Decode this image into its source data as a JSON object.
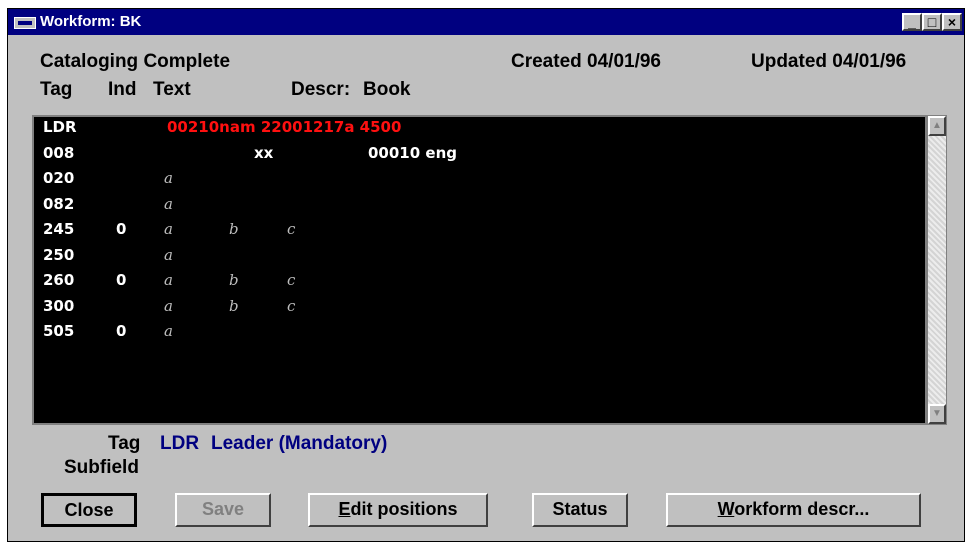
{
  "window": {
    "title": "Workform: BK",
    "controls": {
      "minimize": "_",
      "maximize": "□",
      "close": "×"
    }
  },
  "header": {
    "status": "Cataloging Complete",
    "created": "Created 04/01/96",
    "updated": "Updated 04/01/96",
    "col_tag": "Tag",
    "col_ind": "Ind",
    "col_text": "Text",
    "descr_label": "Descr:",
    "descr_value": "Book"
  },
  "records": [
    {
      "tag": "LDR",
      "ind": "",
      "text": "00210nam  22001217a 4500",
      "red": true,
      "subfields": []
    },
    {
      "tag": "008",
      "ind": "",
      "text": "xx",
      "text2": "00010 eng",
      "subfields": []
    },
    {
      "tag": "020",
      "ind": "",
      "text": "",
      "subfields": [
        "a"
      ]
    },
    {
      "tag": "082",
      "ind": "",
      "text": "",
      "subfields": [
        "a"
      ]
    },
    {
      "tag": "245",
      "ind": "0",
      "text": "",
      "subfields": [
        "a",
        "b",
        "c"
      ]
    },
    {
      "tag": "250",
      "ind": "",
      "text": "",
      "subfields": [
        "a"
      ]
    },
    {
      "tag": "260",
      "ind": "0",
      "text": "",
      "subfields": [
        "a",
        "b",
        "c"
      ]
    },
    {
      "tag": "300",
      "ind": "",
      "text": "",
      "subfields": [
        "a",
        "b",
        "c"
      ]
    },
    {
      "tag": "505",
      "ind": "0",
      "text": "",
      "subfields": [
        "a"
      ]
    }
  ],
  "info": {
    "tag_label": "Tag",
    "tag_value": "LDR",
    "tag_desc": "Leader (Mandatory)",
    "subfield_label": "Subfield"
  },
  "buttons": {
    "close": "Close",
    "save": "Save",
    "edit_positions_underline": "E",
    "edit_positions_rest": "dit positions",
    "status": "Status",
    "workform_underline": "W",
    "workform_rest": "orkform descr..."
  },
  "colors": {
    "titlebar": "#000080",
    "list_bg": "#000000",
    "leader_text": "#ff1010",
    "info_blue": "#000080"
  }
}
